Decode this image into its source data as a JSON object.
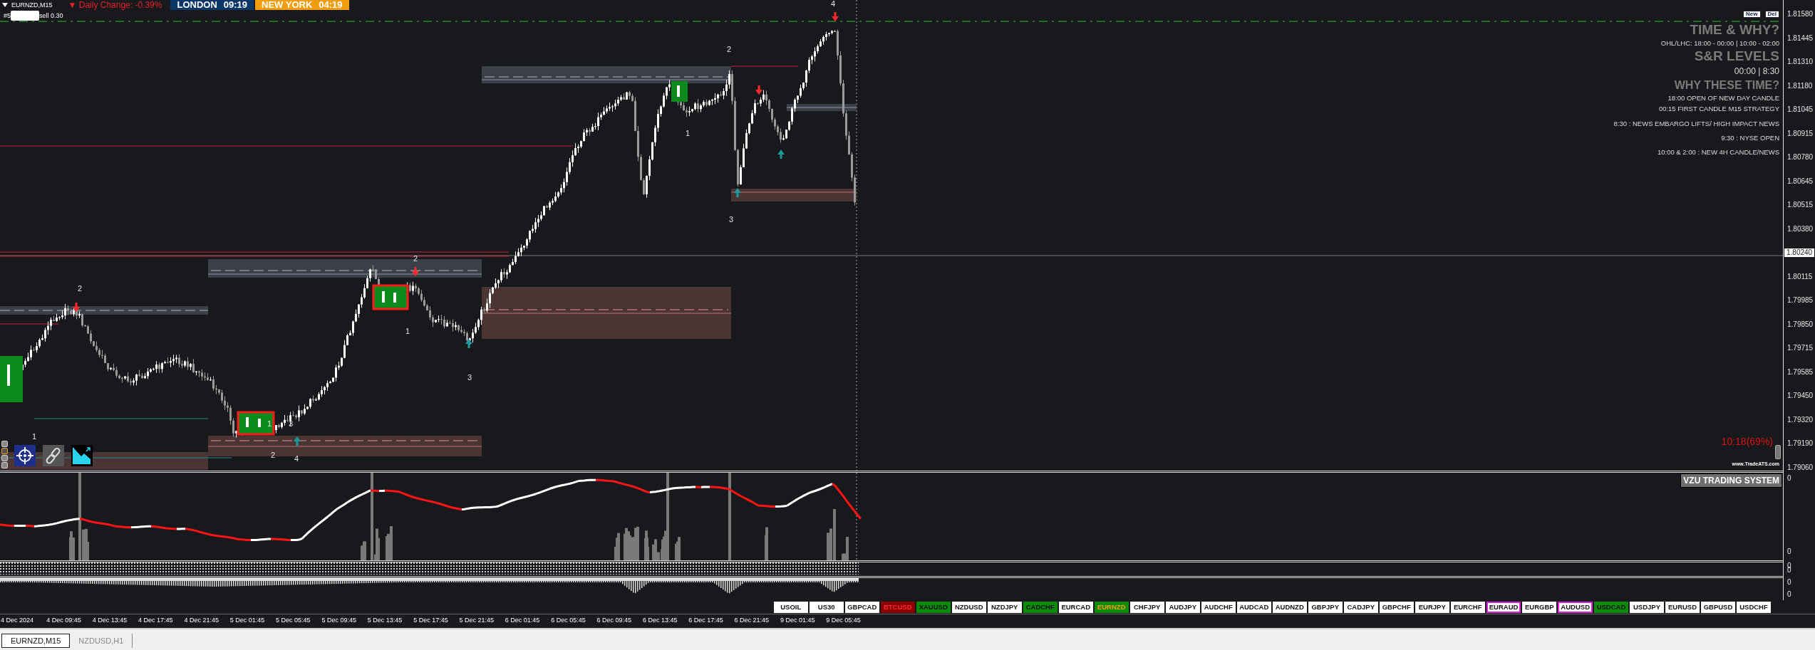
{
  "header": {
    "symbol": "EURNZD,M15",
    "daily_change": "▼ Daily Change: -0.39%",
    "sessions": [
      {
        "city": "LONDON",
        "time": "09:19",
        "color": "#0b3768"
      },
      {
        "city": "NEW YORK",
        "time": "04:19",
        "color": "#f29d0e"
      }
    ]
  },
  "order_line": {
    "prefix": "#5",
    "label": "sell 0.30"
  },
  "buttons": [
    "New",
    "Del"
  ],
  "info_panel": [
    {
      "kind": "heading",
      "text": "TIME & WHY?"
    },
    {
      "kind": "detail",
      "text": "OHL/LHC: 18:00 - 00:00 | 10:00 - 02:00"
    },
    {
      "kind": "heading",
      "text": "S&R LEVELS"
    },
    {
      "kind": "times",
      "text": "00:00 | 8:30"
    },
    {
      "kind": "subheading",
      "text": "WHY THESE TIME?"
    },
    {
      "kind": "detail",
      "text": "18:00 OPEN OF NEW DAY CANDLE"
    },
    {
      "kind": "detail",
      "text": "00:15 FIRST CANDLE M15 STRATEGY"
    },
    {
      "kind": "note",
      "text": "8:30 : NEWS EMBARGO LIFTS/ HIGH IMPACT NEWS"
    },
    {
      "kind": "note",
      "text": "9:30 : NYSE OPEN"
    },
    {
      "kind": "note",
      "text": "10:00 & 2:00 : NEW 4H CANDLE/NEWS"
    }
  ],
  "candle_timer": "10:18(69%)",
  "credit": "www.TradeATS.com",
  "wave_labels": [
    {
      "text": "4"
    },
    {
      "text": "2"
    },
    {
      "text": "1"
    },
    {
      "text": "3"
    },
    {
      "text": "2"
    },
    {
      "text": "2"
    },
    {
      "text": "1"
    },
    {
      "text": "3"
    },
    {
      "text": "1"
    },
    {
      "text": "3"
    },
    {
      "text": "1"
    },
    {
      "text": "2"
    },
    {
      "text": "4"
    }
  ],
  "toggles": [
    {
      "selected": false
    },
    {
      "selected": true
    },
    {
      "selected": false
    },
    {
      "selected": false
    }
  ],
  "price_axis": [
    {
      "text": "1.81580",
      "kind": "tick"
    },
    {
      "text": "1.81445",
      "kind": "tick"
    },
    {
      "text": "1.81310",
      "kind": "tick"
    },
    {
      "text": "1.81180",
      "kind": "tick"
    },
    {
      "text": "1.81045",
      "kind": "tick"
    },
    {
      "text": "1.80915",
      "kind": "tick"
    },
    {
      "text": "1.80780",
      "kind": "tick"
    },
    {
      "text": "1.80645",
      "kind": "tick"
    },
    {
      "text": "1.80515",
      "kind": "tick"
    },
    {
      "text": "1.80380",
      "kind": "tick"
    },
    {
      "text": "1.80240",
      "kind": "current"
    },
    {
      "text": "1.80115",
      "kind": "tick"
    },
    {
      "text": "1.79985",
      "kind": "tick"
    },
    {
      "text": "1.79850",
      "kind": "tick"
    },
    {
      "text": "1.79715",
      "kind": "tick"
    },
    {
      "text": "1.79585",
      "kind": "tick"
    },
    {
      "text": "1.79450",
      "kind": "tick"
    },
    {
      "text": "1.79320",
      "kind": "tick"
    },
    {
      "text": "1.79190",
      "kind": "tick"
    },
    {
      "text": "1.79060",
      "kind": "tick"
    }
  ],
  "indicator": {
    "title": "VZU TRADING SYSTEM",
    "axis": [
      "0",
      "0"
    ]
  },
  "sub_panels": [
    {
      "axis": [
        "0",
        "0"
      ]
    },
    {
      "axis": [
        "0",
        "0"
      ]
    }
  ],
  "symbols": [
    {
      "text": "USOIL",
      "kind": "plain"
    },
    {
      "text": "US30",
      "kind": "plain"
    },
    {
      "text": "GBPCAD",
      "kind": "plain"
    },
    {
      "text": "BTCUSD",
      "kind": "down"
    },
    {
      "text": "XAUUSD",
      "kind": "up"
    },
    {
      "text": "NZDUSD",
      "kind": "plain"
    },
    {
      "text": "NZDJPY",
      "kind": "plain"
    },
    {
      "text": "CADCHF",
      "kind": "up"
    },
    {
      "text": "EURCAD",
      "kind": "plain"
    },
    {
      "text": "EURNZD",
      "kind": "current"
    },
    {
      "text": "CHFJPY",
      "kind": "plain"
    },
    {
      "text": "AUDJPY",
      "kind": "plain"
    },
    {
      "text": "AUDCHF",
      "kind": "plain"
    },
    {
      "text": "AUDCAD",
      "kind": "plain"
    },
    {
      "text": "AUDNZD",
      "kind": "plain"
    },
    {
      "text": "GBPJPY",
      "kind": "plain"
    },
    {
      "text": "CADJPY",
      "kind": "plain"
    },
    {
      "text": "GBPCHF",
      "kind": "plain"
    },
    {
      "text": "EURJPY",
      "kind": "plain"
    },
    {
      "text": "EURCHF",
      "kind": "plain"
    },
    {
      "text": "EURAUD",
      "kind": "alert"
    },
    {
      "text": "EURGBP",
      "kind": "plain"
    },
    {
      "text": "AUDUSD",
      "kind": "alert"
    },
    {
      "text": "USDCAD",
      "kind": "up"
    },
    {
      "text": "USDJPY",
      "kind": "plain"
    },
    {
      "text": "EURUSD",
      "kind": "plain"
    },
    {
      "text": "GBPUSD",
      "kind": "plain"
    },
    {
      "text": "USDCHF",
      "kind": "plain"
    }
  ],
  "time_axis": [
    "4 Dec 2024",
    "4 Dec 09:45",
    "4 Dec 13:45",
    "4 Dec 17:45",
    "4 Dec 21:45",
    "5 Dec 01:45",
    "5 Dec 05:45",
    "5 Dec 09:45",
    "5 Dec 13:45",
    "5 Dec 17:45",
    "5 Dec 21:45",
    "6 Dec 01:45",
    "6 Dec 05:45",
    "6 Dec 09:45",
    "6 Dec 13:45",
    "6 Dec 17:45",
    "6 Dec 21:45",
    "9 Dec 01:45",
    "9 Dec 05:45"
  ],
  "tabs": [
    {
      "label": "EURNZD,M15",
      "selected": true
    },
    {
      "label": "NZDUSD,H1",
      "selected": false
    }
  ]
}
